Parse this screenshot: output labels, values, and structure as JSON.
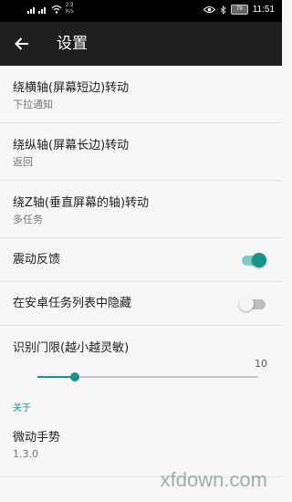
{
  "status_bar": {
    "speed_value": "2.3",
    "speed_unit": "K/s",
    "battery": "79",
    "time": "11:51"
  },
  "app_bar": {
    "back_icon": "arrow-left-icon",
    "title": "设置"
  },
  "settings": {
    "items": [
      {
        "title": "绕横轴(屏幕短边)转动",
        "subtitle": "下拉通知"
      },
      {
        "title": "绕纵轴(屏幕长边)转动",
        "subtitle": "返回"
      },
      {
        "title": "绕Z轴(垂直屏幕的轴)转动",
        "subtitle": "多任务"
      }
    ],
    "vibration": {
      "title": "震动反馈",
      "enabled": true
    },
    "hide_recents": {
      "title": "在安卓任务列表中隐藏",
      "enabled": false
    },
    "threshold": {
      "title": "识别门限(越小越灵敏)",
      "max_label": "10",
      "value_fraction": 0.17
    }
  },
  "about": {
    "header": "关于",
    "app_name": "微动手势",
    "version": "1.3.0"
  },
  "watermark": "xfdown.com",
  "colors": {
    "accent": "#129688",
    "appbar": "#1f1f1f"
  }
}
